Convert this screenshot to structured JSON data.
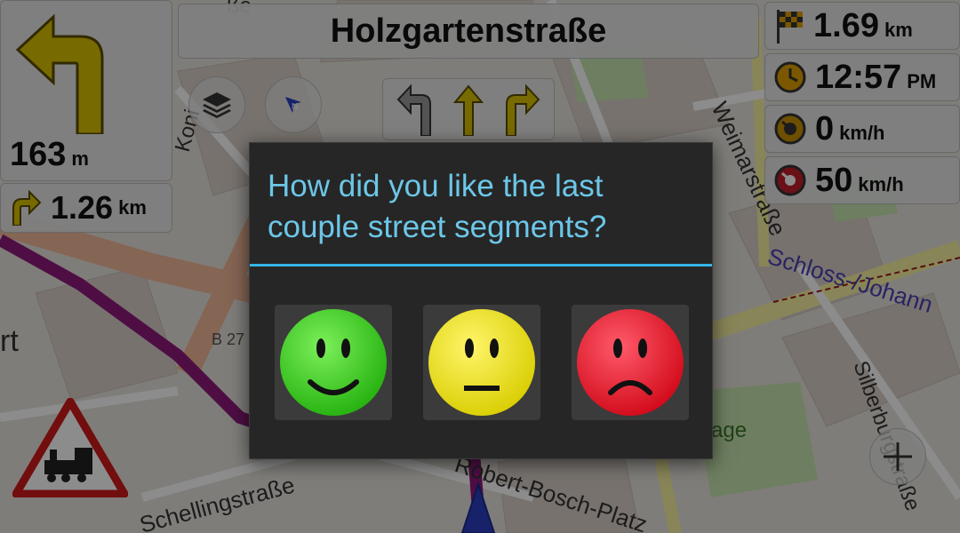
{
  "navigation": {
    "street_name": "Holzgartenstraße",
    "turn": {
      "icon": "turn-left-arrow-icon",
      "distance_value": "163",
      "distance_unit": "m"
    },
    "next_turn": {
      "icon": "turn-right-small-icon",
      "distance_value": "1.26",
      "distance_unit": "km"
    },
    "lanes": [
      {
        "icon": "lane-left-icon",
        "active": false
      },
      {
        "icon": "lane-straight-icon",
        "active": true
      },
      {
        "icon": "lane-right-icon",
        "active": true
      }
    ]
  },
  "info_panels": [
    {
      "icon": "checkered-flag-icon",
      "value": "1.69",
      "unit": "km"
    },
    {
      "icon": "clock-icon",
      "value": "12:57",
      "unit": "PM"
    },
    {
      "icon": "speedometer-icon",
      "value": "0",
      "unit": "km/h"
    },
    {
      "icon": "speed-limit-icon",
      "value": "50",
      "unit": "km/h"
    }
  ],
  "map_labels": {
    "top_partial": "ße",
    "koni": "Koni",
    "weimarstrasse": "Weimarstraße",
    "schloss": "Schloss-/Johann",
    "silberburgstrasse": "Silberburgstraße",
    "schellingstrasse": "Schellingstraße",
    "robert_bosch_platz": "Robert-Bosch-Platz",
    "rt": "rt",
    "b27": "B 27",
    "age": "age"
  },
  "dialog": {
    "title": "How did you like the last couple street segments?",
    "options": [
      {
        "icon": "happy-face-icon",
        "color": "#3ad21a"
      },
      {
        "icon": "neutral-face-icon",
        "color": "#f0ea1a"
      },
      {
        "icon": "sad-face-icon",
        "color": "#e8102a"
      }
    ]
  },
  "colors": {
    "route": "#8e1b7d",
    "accent": "#33b5e5",
    "dialog_bg": "#262626"
  },
  "warning_sign": {
    "icon": "railway-crossing-warning-icon"
  }
}
